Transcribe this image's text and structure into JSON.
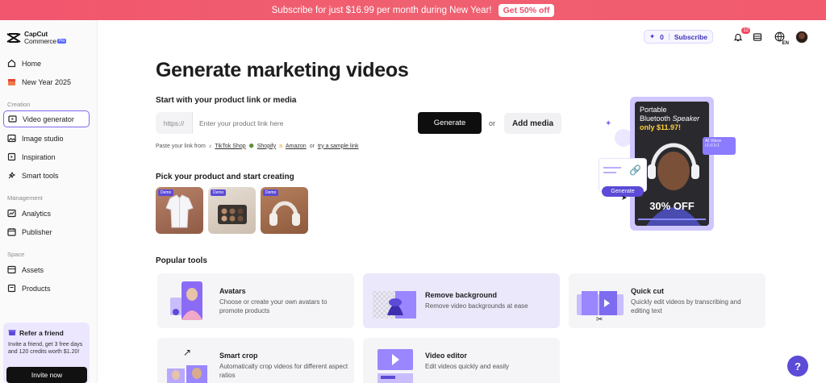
{
  "banner": {
    "text": "Subscribe for just $16.99 per month during New Year!",
    "cta": "Get 50% off"
  },
  "logo": {
    "line1": "CapCut",
    "line2": "Commerce",
    "badge": "Pro"
  },
  "sidebar": {
    "items": [
      {
        "label": "Home",
        "icon": "home-icon"
      },
      {
        "label": "New Year 2025",
        "icon": "calendar-icon"
      }
    ],
    "sections": [
      {
        "label": "Creation",
        "items": [
          {
            "label": "Video generator",
            "icon": "video-icon",
            "active": true
          },
          {
            "label": "Image studio",
            "icon": "image-icon"
          },
          {
            "label": "Inspiration",
            "icon": "inspiration-icon"
          },
          {
            "label": "Smart tools",
            "icon": "tools-icon"
          }
        ]
      },
      {
        "label": "Management",
        "items": [
          {
            "label": "Analytics",
            "icon": "analytics-icon"
          },
          {
            "label": "Publisher",
            "icon": "calendar-icon"
          }
        ]
      },
      {
        "label": "Space",
        "items": [
          {
            "label": "Assets",
            "icon": "assets-icon"
          },
          {
            "label": "Products",
            "icon": "products-icon"
          }
        ]
      }
    ],
    "refer": {
      "title": "Refer a friend",
      "text": "Invite a friend, get 3 free days and 120 credits worth $1.20!",
      "button": "Invite now"
    }
  },
  "header": {
    "credits": "0",
    "subscribe": "Subscribe",
    "notification_count": "12",
    "language": "EN"
  },
  "main": {
    "title": "Generate marketing videos",
    "start_heading": "Start with your product link or media",
    "url_prefix": "https://",
    "url_placeholder": "Enter your product link here",
    "generate_label": "Generate",
    "or_label": "or",
    "add_media_label": "Add media",
    "paste_prefix": "Paste your link from",
    "sources": [
      "TikTok Shop",
      "Shopify",
      "Amazon"
    ],
    "paste_or": "or",
    "sample_link": "try a sample link",
    "pick_heading": "Pick your product and start creating",
    "products": [
      {
        "name": "shirt",
        "tag": "Demo"
      },
      {
        "name": "eyeshadow palette",
        "tag": "Demo"
      },
      {
        "name": "headphones",
        "tag": "Demo"
      }
    ],
    "promo": {
      "line1": "Portable",
      "line2": "Bluetooth",
      "line2b": "Speaker",
      "price": "only $11.97!",
      "off": "30% OFF",
      "ai_voice": "AI Voice",
      "generate": "Generate"
    }
  },
  "tools": {
    "heading": "Popular tools",
    "items": [
      {
        "name": "Avatars",
        "desc": "Choose or create your own avatars to promote products"
      },
      {
        "name": "Remove background",
        "desc": "Remove video backgrounds at ease"
      },
      {
        "name": "Quick cut",
        "desc": "Quickly edit videos by transcribing and editing text"
      },
      {
        "name": "Smart crop",
        "desc": "Automatically crop videos for different aspect ratios"
      },
      {
        "name": "Video editor",
        "desc": "Edit videos quickly and easily"
      }
    ]
  },
  "colors": {
    "accent": "#5b4bd6",
    "banner": "#f2556e",
    "active_border": "#7d6bf0"
  }
}
